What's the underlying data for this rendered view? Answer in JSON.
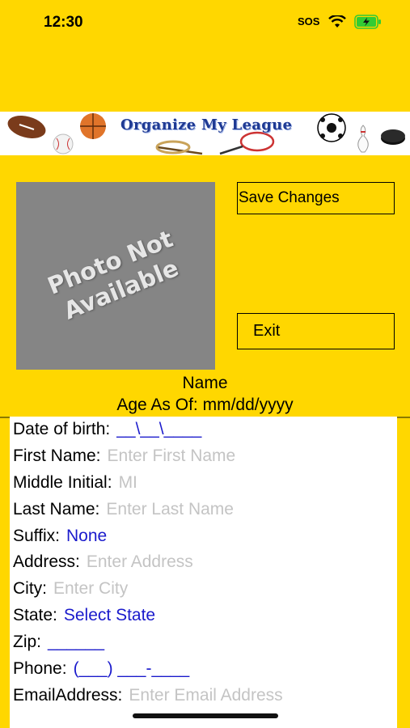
{
  "status_bar": {
    "time": "12:30",
    "carrier": "SOS",
    "battery_color": "#33cc33"
  },
  "banner": {
    "title": "Organize My League"
  },
  "photo": {
    "text": "Photo Not\nAvailable"
  },
  "buttons": {
    "save": "Save Changes",
    "exit": "Exit"
  },
  "profile": {
    "name": "Name",
    "age": "Age As Of: mm/dd/yyyy"
  },
  "form": {
    "dob_label": "Date of birth:",
    "dob_value": "__\\__\\____",
    "first_label": "First Name:",
    "first_placeholder": "Enter First Name",
    "middle_label": "Middle Initial:",
    "middle_placeholder": "MI",
    "last_label": "Last Name:",
    "last_placeholder": "Enter Last Name",
    "suffix_label": "Suffix:",
    "suffix_value": "None",
    "address_label": "Address:",
    "address_placeholder": "Enter Address",
    "city_label": "City:",
    "city_placeholder": "Enter City",
    "state_label": "State:",
    "state_value": "Select State",
    "zip_label": "Zip:",
    "zip_value": "______",
    "phone_label": "Phone:",
    "phone_value": "(___) ___-____",
    "email_label": "EmailAddress:",
    "email_placeholder": "Enter Email Address"
  },
  "colors": {
    "background": "#FFD700",
    "link_blue": "#1a1acc",
    "placeholder_gray": "#c4c4c4"
  }
}
